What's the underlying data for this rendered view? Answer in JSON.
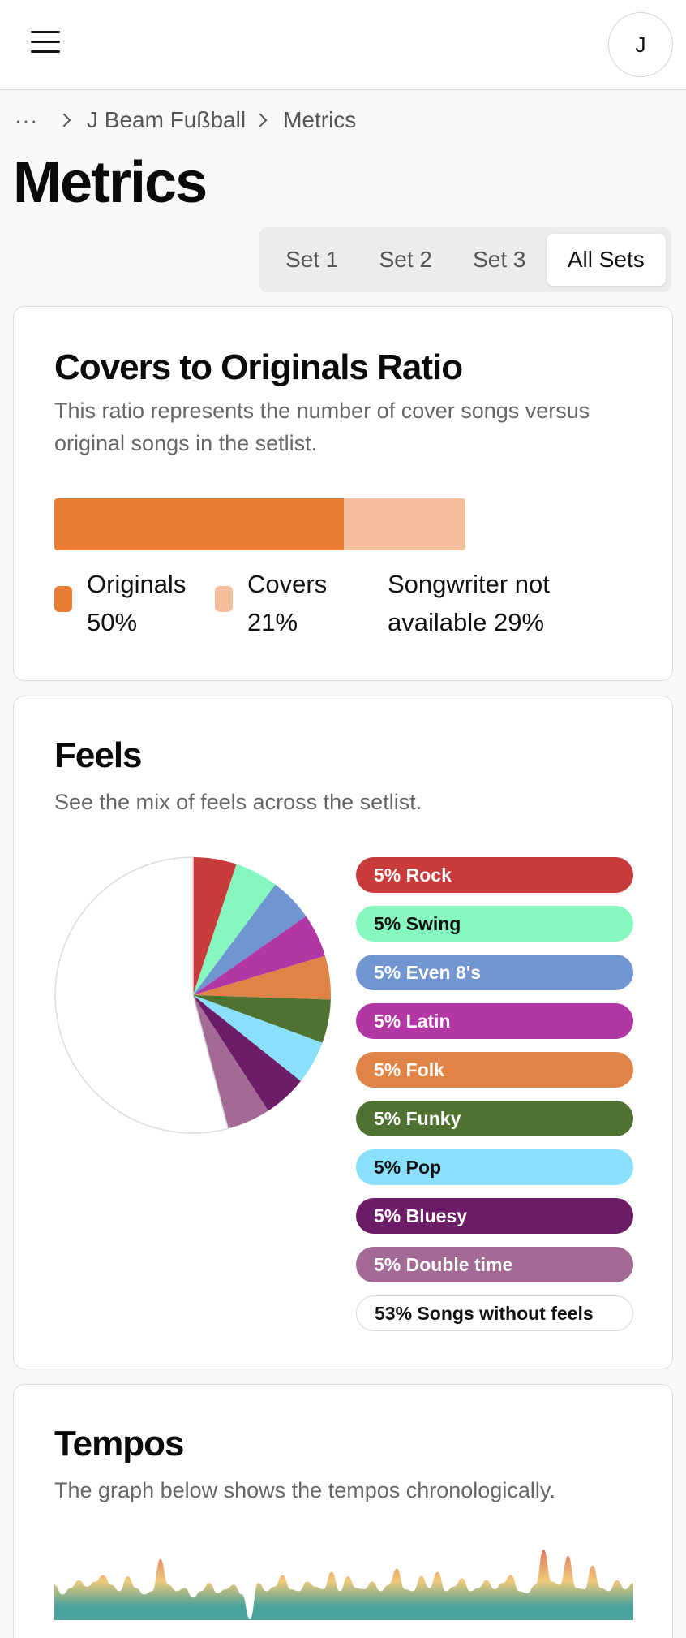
{
  "header": {
    "avatar_initial": "J"
  },
  "breadcrumb": {
    "ellipsis": "···",
    "items": [
      "J Beam Fußball",
      "Metrics"
    ]
  },
  "page": {
    "title": "Metrics"
  },
  "tabs": [
    {
      "label": "Set 1",
      "active": false
    },
    {
      "label": "Set 2",
      "active": false
    },
    {
      "label": "Set 3",
      "active": false
    },
    {
      "label": "All Sets",
      "active": true
    }
  ],
  "ratio_card": {
    "title": "Covers to Originals Ratio",
    "description": "This ratio represents the number of cover songs versus original songs in the setlist.",
    "segments": [
      {
        "name": "Originals",
        "percent": 50,
        "color": "#ea7d34"
      },
      {
        "name": "Covers",
        "percent": 21,
        "color": "#f4bd9b"
      },
      {
        "name": "Songwriter not available",
        "percent": 29,
        "color": "#ffffff"
      }
    ],
    "legend": [
      {
        "line1": "Originals",
        "line2": "50%"
      },
      {
        "line1": "Covers",
        "line2": "21%"
      },
      {
        "line1": "Songwriter not",
        "line2": "available 29%"
      }
    ]
  },
  "feels_card": {
    "title": "Feels",
    "description": "See the mix of feels across the setlist.",
    "items": [
      {
        "label": "5% Rock",
        "percent": 5,
        "color": "#c93b3b",
        "text_color": "#ffffff"
      },
      {
        "label": "5% Swing",
        "percent": 5,
        "color": "#86f7bf",
        "text_color": "#111111"
      },
      {
        "label": "5% Even 8's",
        "percent": 5,
        "color": "#7195d1",
        "text_color": "#ffffff"
      },
      {
        "label": "5% Latin",
        "percent": 5,
        "color": "#b336a5",
        "text_color": "#ffffff"
      },
      {
        "label": "5% Folk",
        "percent": 5,
        "color": "#e08347",
        "text_color": "#ffffff"
      },
      {
        "label": "5% Funky",
        "percent": 5,
        "color": "#4f7233",
        "text_color": "#ffffff"
      },
      {
        "label": "5% Pop",
        "percent": 5,
        "color": "#8ae0fb",
        "text_color": "#111111"
      },
      {
        "label": "5% Bluesy",
        "percent": 5,
        "color": "#6d1c68",
        "text_color": "#ffffff"
      },
      {
        "label": "5% Double time",
        "percent": 5,
        "color": "#a26a94",
        "text_color": "#ffffff"
      },
      {
        "label": "53% Songs without feels",
        "percent": 53,
        "color": "#ffffff",
        "text_color": "#111111"
      }
    ]
  },
  "tempos_card": {
    "title": "Tempos",
    "description": "The graph below shows the tempos chronologically.",
    "gradient": [
      "#e0785f",
      "#f0c97a",
      "#4aa39a"
    ],
    "values": [
      55,
      40,
      50,
      62,
      52,
      60,
      70,
      55,
      45,
      68,
      50,
      40,
      45,
      95,
      55,
      45,
      50,
      35,
      45,
      58,
      42,
      48,
      55,
      40,
      2,
      58,
      45,
      52,
      70,
      48,
      45,
      60,
      52,
      48,
      75,
      45,
      68,
      50,
      48,
      60,
      45,
      55,
      80,
      48,
      45,
      68,
      50,
      75,
      45,
      52,
      65,
      45,
      50,
      62,
      48,
      58,
      70,
      45,
      42,
      55,
      110,
      60,
      55,
      100,
      50,
      48,
      85,
      50,
      45,
      62,
      48,
      58
    ]
  }
}
